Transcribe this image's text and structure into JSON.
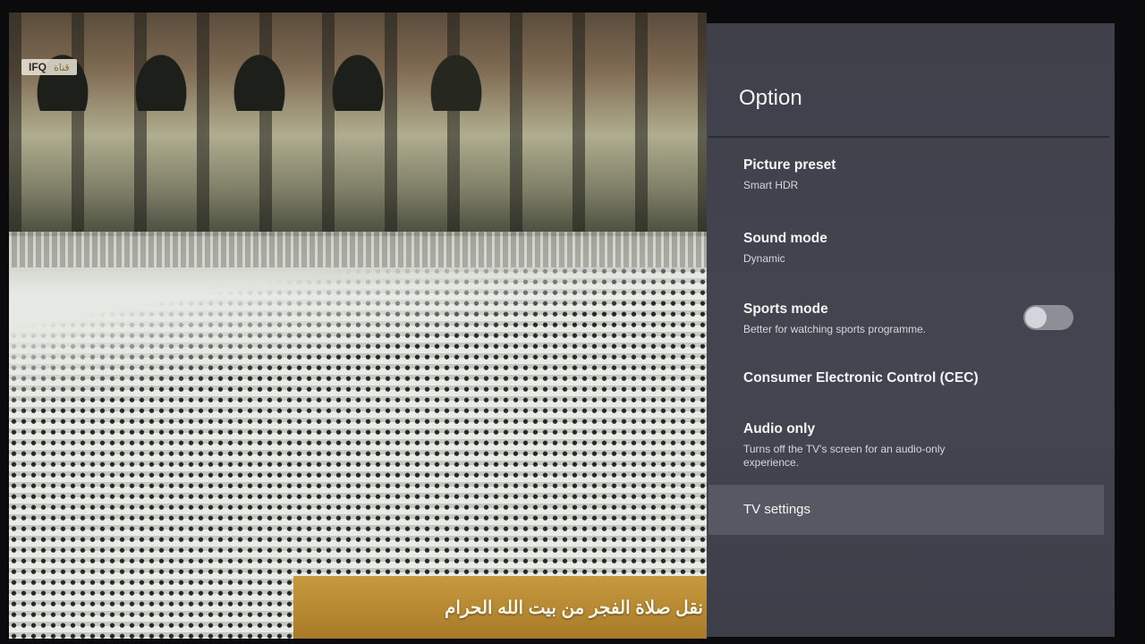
{
  "video": {
    "channel_logo": "IFQ",
    "channel_logo_sub": "ﻗﻨﺎﺓ",
    "ticker_text": "نقل صلاة الفجر من بيت الله الحرام"
  },
  "panel": {
    "title": "Option",
    "items": [
      {
        "label": "Picture preset",
        "value": "Smart HDR"
      },
      {
        "label": "Sound mode",
        "value": "Dynamic"
      },
      {
        "label": "Sports mode",
        "description": "Better for watching sports programme.",
        "toggle_on": false
      },
      {
        "label": "Consumer Electronic Control (CEC)"
      },
      {
        "label": "Audio only",
        "description": "Turns off the TV's screen for an audio-only experience."
      },
      {
        "label": "TV settings",
        "selected": true
      }
    ]
  },
  "colors": {
    "panel_bg": "#42434d",
    "selected_bg": "#575863",
    "toggle_off": "#8d8e96"
  }
}
